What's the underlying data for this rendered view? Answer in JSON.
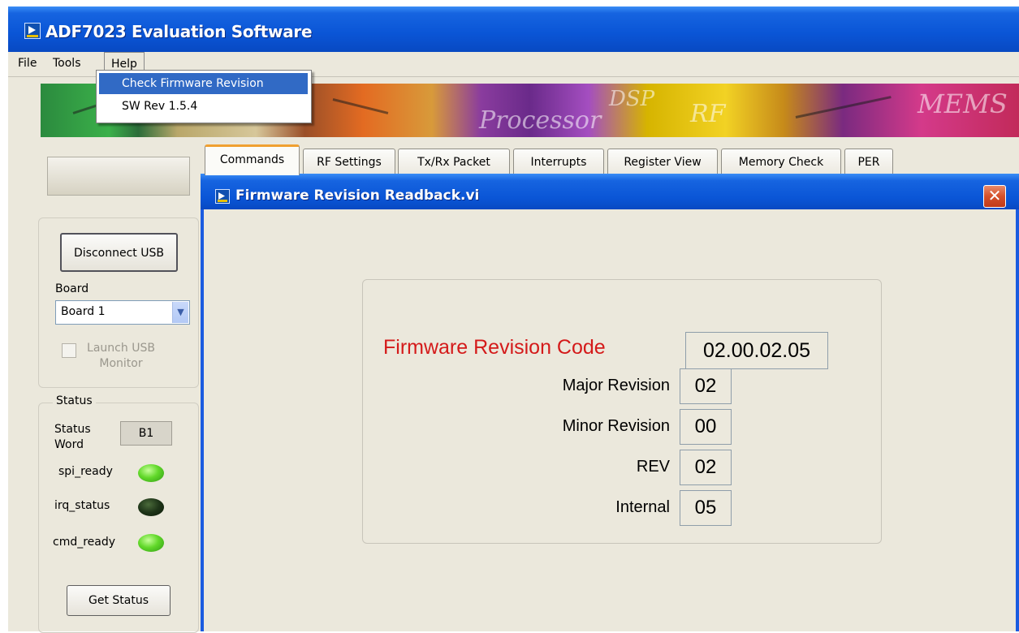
{
  "app": {
    "title": "ADF7023 Evaluation Software"
  },
  "menu": {
    "items": [
      "File",
      "Tools",
      "Help"
    ],
    "help_dropdown": [
      "Check Firmware Revision",
      "SW Rev 1.5.4"
    ]
  },
  "banner": {
    "words": [
      "Processor",
      "DSP",
      "RF",
      "MEMS"
    ]
  },
  "sidebar": {
    "disconnect_label": "Disconnect USB",
    "board_label": "Board",
    "board_selected": "Board 1",
    "launch_monitor_label": "Launch USB Monitor",
    "status_group_label": "Status",
    "status_word_label": "Status Word",
    "status_word_value": "B1",
    "indicators": [
      {
        "label": "spi_ready",
        "state": "on"
      },
      {
        "label": "irq_status",
        "state": "off"
      },
      {
        "label": "cmd_ready",
        "state": "on"
      }
    ],
    "get_status_label": "Get Status"
  },
  "tabs": [
    "Commands",
    "RF Settings",
    "Tx/Rx Packet",
    "Interrupts",
    "Register View",
    "Memory Check",
    "PER"
  ],
  "active_tab": "Commands",
  "subwindow": {
    "title": "Firmware Revision Readback.vi",
    "close_glyph": "✕",
    "code_label": "Firmware Revision Code",
    "code_value": "02.00.02.05",
    "fields": [
      {
        "label": "Major Revision",
        "value": "02"
      },
      {
        "label": "Minor Revision",
        "value": "00"
      },
      {
        "label": "REV",
        "value": "02"
      },
      {
        "label": "Internal",
        "value": "05"
      }
    ]
  },
  "colors": {
    "titlebar": "#0a55d6",
    "code_label": "#d41a1a",
    "led_on": "#62d92a",
    "led_off": "#1e3418",
    "menu_highlight": "#316ac5"
  }
}
